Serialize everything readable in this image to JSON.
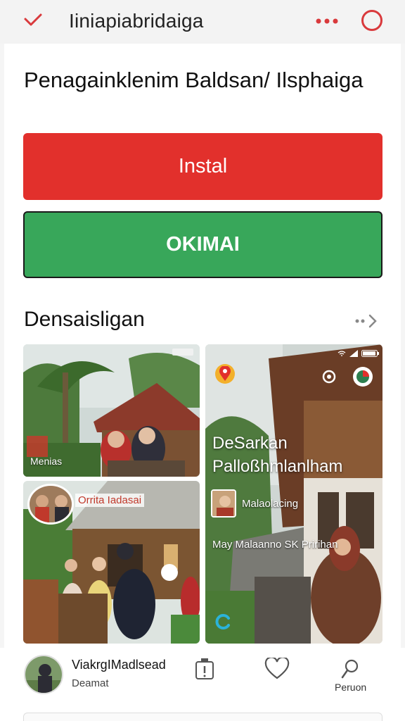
{
  "header": {
    "title": "Iiniapiabridaiga"
  },
  "main": {
    "heading": "Penagainklenim Baldsan/ Ilsphaiga",
    "install_label": "Instal",
    "open_label": "OKIMAI"
  },
  "section": {
    "title": "Densaisligan"
  },
  "cards": {
    "a": {
      "tag": "Menias"
    },
    "b": {
      "tag": "Orrita Iadasai"
    },
    "c": {
      "title": "DeSarkan Palloßhmlanlham",
      "subtitle": "Malaolacing",
      "line": "May Malaanno SK Pririhan"
    }
  },
  "bottom": {
    "profile_name": "ViakrgIMadlsead",
    "profile_sub": "Deamat",
    "person_label": "Peruon"
  },
  "colors": {
    "accent_red": "#e2302c",
    "accent_green": "#38a75a"
  }
}
